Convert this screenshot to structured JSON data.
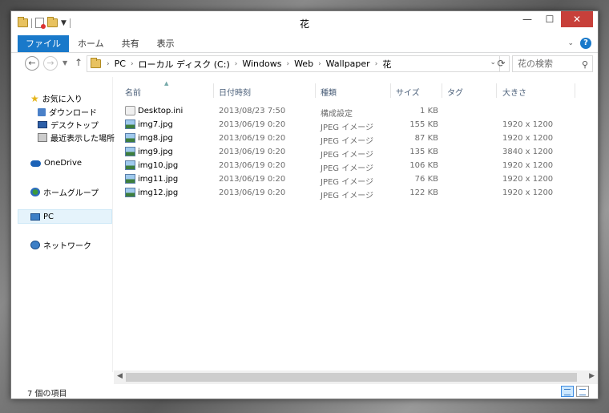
{
  "window": {
    "title": "花"
  },
  "ribbon": {
    "tabs": [
      "ファイル",
      "ホーム",
      "共有",
      "表示"
    ]
  },
  "address": {
    "crumbs": [
      "PC",
      "ローカル ディスク (C:)",
      "Windows",
      "Web",
      "Wallpaper",
      "花"
    ],
    "search_placeholder": "花の検索"
  },
  "nav": {
    "favorites_label": "お気に入り",
    "favorites": [
      "ダウンロード",
      "デスクトップ",
      "最近表示した場所"
    ],
    "onedrive": "OneDrive",
    "homegroup": "ホームグループ",
    "pc": "PC",
    "network": "ネットワーク"
  },
  "columns": {
    "name": "名前",
    "date": "日付時刻",
    "type": "種類",
    "size": "サイズ",
    "tag": "タグ",
    "dimensions": "大きさ"
  },
  "files": [
    {
      "name": "Desktop.ini",
      "date": "2013/08/23 7:50",
      "type": "構成設定",
      "size": "1 KB",
      "dimensions": "",
      "icon": "ini-file-icon"
    },
    {
      "name": "img7.jpg",
      "date": "2013/06/19 0:20",
      "type": "JPEG イメージ",
      "size": "155 KB",
      "dimensions": "1920 x 1200",
      "icon": "image-file-icon"
    },
    {
      "name": "img8.jpg",
      "date": "2013/06/19 0:20",
      "type": "JPEG イメージ",
      "size": "87 KB",
      "dimensions": "1920 x 1200",
      "icon": "image-file-icon"
    },
    {
      "name": "img9.jpg",
      "date": "2013/06/19 0:20",
      "type": "JPEG イメージ",
      "size": "135 KB",
      "dimensions": "3840 x 1200",
      "icon": "image-file-icon"
    },
    {
      "name": "img10.jpg",
      "date": "2013/06/19 0:20",
      "type": "JPEG イメージ",
      "size": "106 KB",
      "dimensions": "1920 x 1200",
      "icon": "image-file-icon"
    },
    {
      "name": "img11.jpg",
      "date": "2013/06/19 0:20",
      "type": "JPEG イメージ",
      "size": "76 KB",
      "dimensions": "1920 x 1200",
      "icon": "image-file-icon"
    },
    {
      "name": "img12.jpg",
      "date": "2013/06/19 0:20",
      "type": "JPEG イメージ",
      "size": "122 KB",
      "dimensions": "1920 x 1200",
      "icon": "image-file-icon"
    }
  ],
  "status": {
    "count_text": "7 個の項目"
  },
  "colors": {
    "accent": "#1979ca",
    "close": "#c7403a",
    "header_text": "#4c607a"
  }
}
